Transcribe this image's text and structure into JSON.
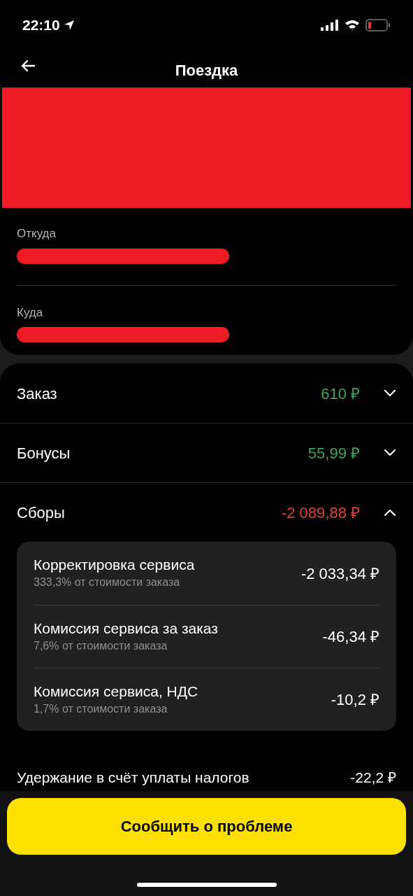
{
  "status_bar": {
    "time": "22:10"
  },
  "header": {
    "title": "Поездка"
  },
  "route": [
    {
      "label": "Откуда"
    },
    {
      "label": "Куда"
    }
  ],
  "sections": [
    {
      "label": "Заказ",
      "amount": "610 ₽",
      "color": "#3fa35d",
      "expanded": false
    },
    {
      "label": "Бонусы",
      "amount": "55,99 ₽",
      "color": "#3fa35d",
      "expanded": false
    },
    {
      "label": "Сборы",
      "amount": "-2 089,88 ₽",
      "color": "#e2403d",
      "expanded": true,
      "items": [
        {
          "title": "Корректировка сервиса",
          "note": "333,3% от стоимости заказа",
          "amount": "-2 033,34 ₽"
        },
        {
          "title": "Комиссия сервиса за заказ",
          "note": "7,6% от стоимости заказа",
          "amount": "-46,34 ₽"
        },
        {
          "title": "Комиссия сервиса, НДС",
          "note": "1,7% от стоимости заказа",
          "amount": "-10,2 ₽"
        }
      ]
    }
  ],
  "tax_row": {
    "label": "Удержание в счёт уплаты налогов",
    "amount": "-22,2 ₽"
  },
  "report_button": "Сообщить о проблеме"
}
